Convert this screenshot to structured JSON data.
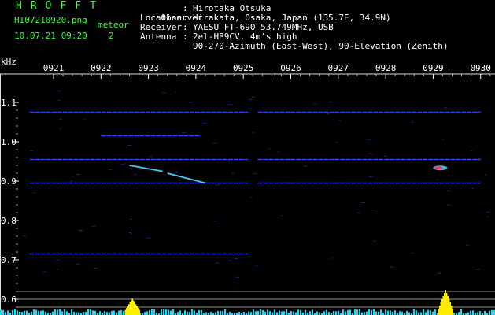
{
  "app": {
    "brand": "HROFFT",
    "filename": "HI07210920.png",
    "datetime": "10.07.21 09:20",
    "meteor_label": "meteor",
    "meteor_count": "2"
  },
  "info": {
    "observer_label": "Observer",
    "observer_value": "Hirotaka Otsuka",
    "location_label": "Location",
    "location_value": "Hirakata, Osaka, Japan (135.7E, 34.9N)",
    "receiver_label": "Receiver",
    "receiver_value": "YAESU FT-690 53.749MHz, USB",
    "antenna_label": "Antenna",
    "antenna_value": "2el-HB9CV, 4m's high",
    "antenna_value2": "90-270-Azimuth (East-West), 90-Elevation (Zenith)",
    "separator": ":"
  },
  "axis": {
    "unit": "kHz",
    "x_ticks": [
      "0921",
      "0922",
      "0923",
      "0924",
      "0925",
      "0926",
      "0927",
      "0928",
      "0929",
      "0930"
    ],
    "y_ticks": [
      "1.1",
      "1.0",
      "0.9",
      "0.8",
      "0.7",
      "0.6"
    ]
  },
  "colors": {
    "green_text": "#33ff33",
    "trace_blue": "#3344ff",
    "meteor_cyan": "#44ccff",
    "activity_cyan": "#00e5ff",
    "activity_yellow": "#ffee00",
    "ref_line": "#bbbbbb"
  },
  "chart_data": {
    "type": "spectrogram",
    "x_unit": "minutes (hhmm)",
    "y_unit": "kHz",
    "xlim": [
      920.5,
      930.0
    ],
    "ylim": [
      0.57,
      1.17
    ],
    "carriers": [
      {
        "y": 1.075,
        "x": [
          920.5,
          925.1
        ]
      },
      {
        "y": 1.075,
        "x": [
          925.3,
          930.0
        ]
      },
      {
        "y": 0.955,
        "x": [
          920.5,
          925.1
        ]
      },
      {
        "y": 0.955,
        "x": [
          925.3,
          930.0
        ]
      },
      {
        "y": 0.895,
        "x": [
          920.5,
          925.1
        ]
      },
      {
        "y": 0.895,
        "x": [
          925.3,
          930.0
        ]
      },
      {
        "y": 0.715,
        "x": [
          920.5,
          925.1
        ]
      },
      {
        "y": 1.015,
        "x": [
          922.0,
          924.1
        ]
      }
    ],
    "meteors": [
      {
        "name": "",
        "x": [
          922.6,
          923.3
        ],
        "y": [
          0.94,
          0.925
        ]
      },
      {
        "name": "",
        "x": [
          923.4,
          924.2
        ],
        "y": [
          0.92,
          0.895
        ]
      },
      {
        "name": "",
        "x": [
          929.0,
          929.3
        ],
        "y": [
          0.935,
          0.932
        ]
      }
    ],
    "activity_bursts": [
      {
        "x": 922.65,
        "level": 0.6
      },
      {
        "x": 929.25,
        "level": 1.0
      }
    ]
  }
}
